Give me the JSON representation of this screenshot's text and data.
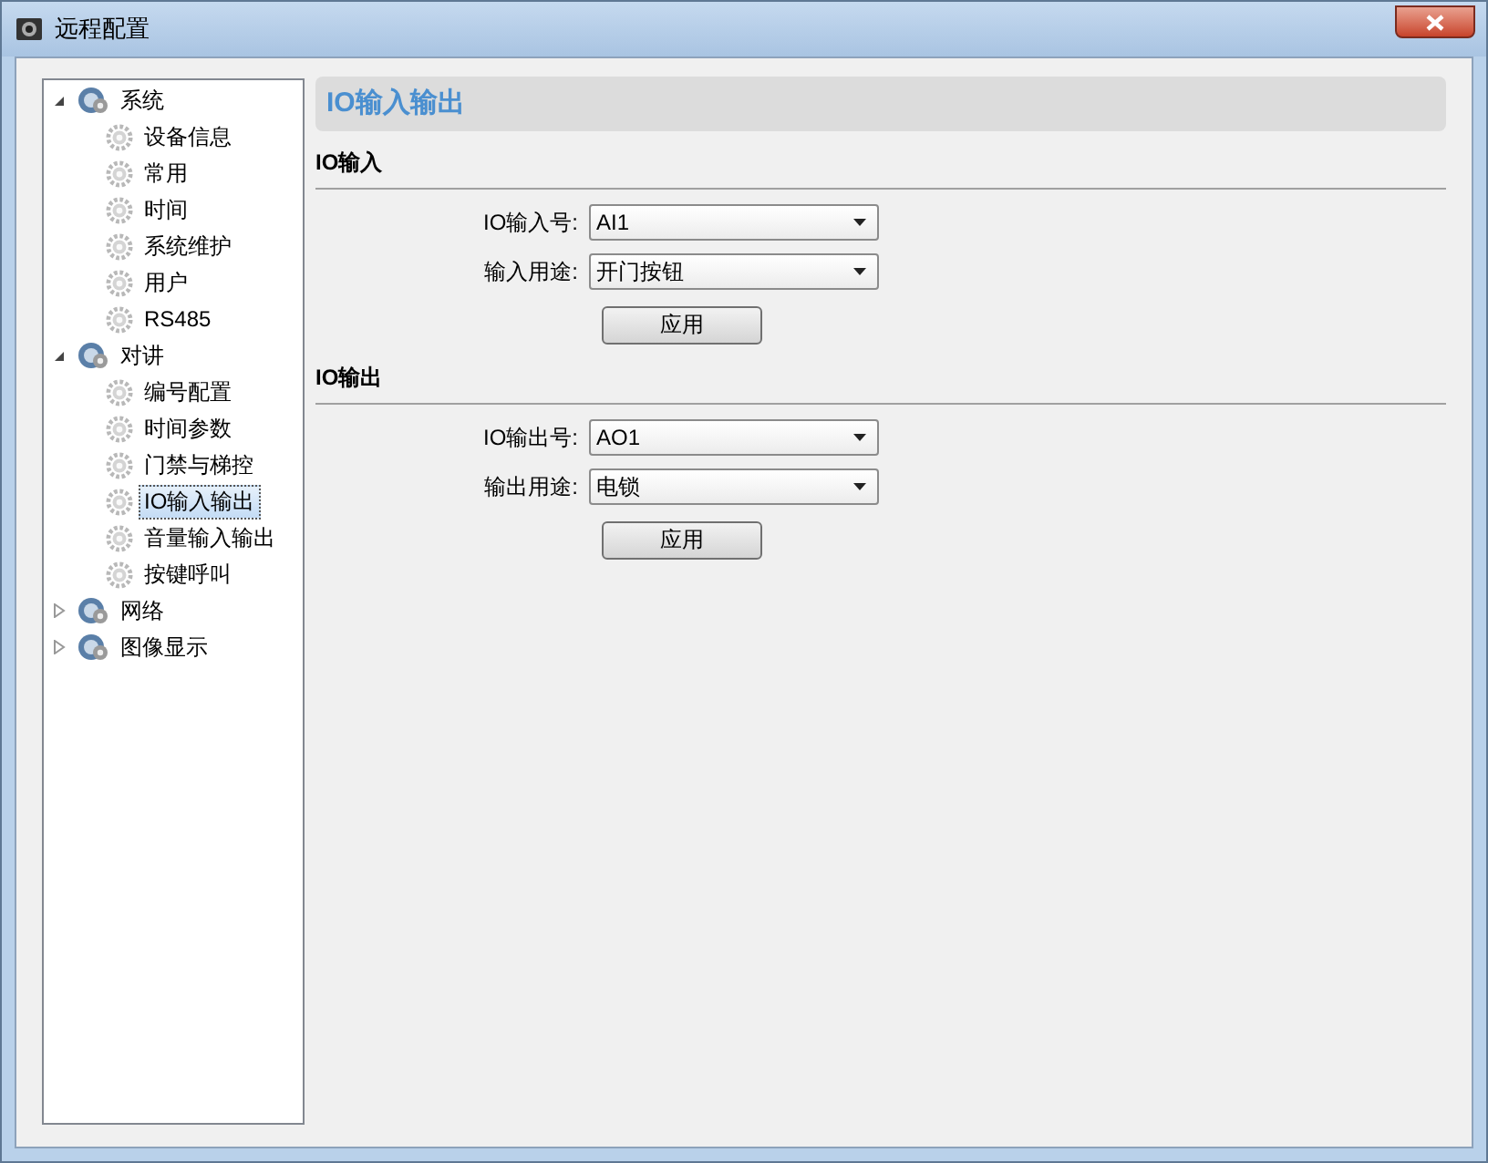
{
  "window": {
    "title": "远程配置"
  },
  "tree": [
    {
      "label": "系统",
      "expanded": true,
      "selected": false,
      "children": [
        {
          "label": "设备信息",
          "selected": false
        },
        {
          "label": "常用",
          "selected": false
        },
        {
          "label": "时间",
          "selected": false
        },
        {
          "label": "系统维护",
          "selected": false
        },
        {
          "label": "用户",
          "selected": false
        },
        {
          "label": "RS485",
          "selected": false
        }
      ]
    },
    {
      "label": "对讲",
      "expanded": true,
      "selected": false,
      "children": [
        {
          "label": "编号配置",
          "selected": false
        },
        {
          "label": "时间参数",
          "selected": false
        },
        {
          "label": "门禁与梯控",
          "selected": false
        },
        {
          "label": "IO输入输出",
          "selected": true
        },
        {
          "label": "音量输入输出",
          "selected": false
        },
        {
          "label": "按键呼叫",
          "selected": false
        }
      ]
    },
    {
      "label": "网络",
      "expanded": false,
      "selected": false
    },
    {
      "label": "图像显示",
      "expanded": false,
      "selected": false
    }
  ],
  "panel": {
    "title": "IO输入输出",
    "sections": [
      {
        "title": "IO输入",
        "fields": [
          {
            "label": "IO输入号:",
            "value": "AI1"
          },
          {
            "label": "输入用途:",
            "value": "开门按钮"
          }
        ],
        "button": "应用"
      },
      {
        "title": "IO输出",
        "fields": [
          {
            "label": "IO输出号:",
            "value": "AO1"
          },
          {
            "label": "输出用途:",
            "value": "电锁"
          }
        ],
        "button": "应用"
      }
    ]
  }
}
